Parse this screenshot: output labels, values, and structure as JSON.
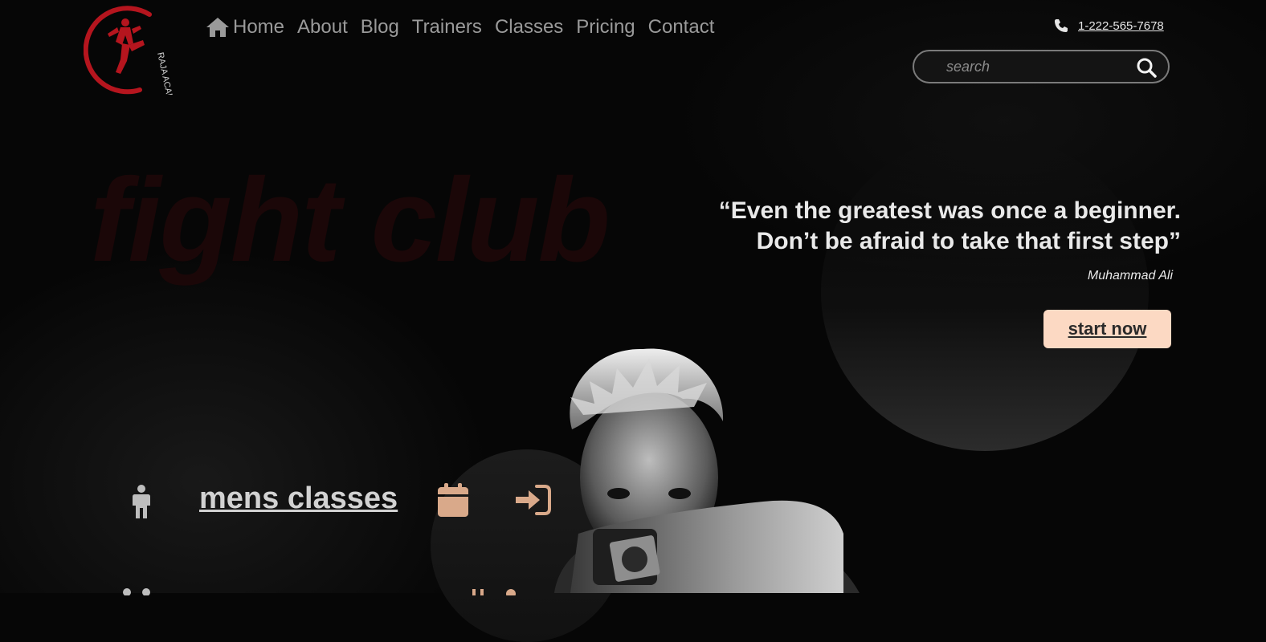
{
  "nav": {
    "items": [
      {
        "label": "Home",
        "icon": "home-icon"
      },
      {
        "label": "About"
      },
      {
        "label": "Blog"
      },
      {
        "label": "Trainers"
      },
      {
        "label": "Classes"
      },
      {
        "label": "Pricing"
      },
      {
        "label": "Contact"
      }
    ]
  },
  "logo": {
    "text": "RAJA ACADEMY",
    "color": "#b5151e"
  },
  "contact": {
    "phone": "1-222-565-7678",
    "icon": "phone-icon"
  },
  "search": {
    "placeholder": "search",
    "icon": "search-icon"
  },
  "hero": {
    "title": "fight club",
    "quote_line1": "“Even the greatest was once a beginner.",
    "quote_line2": "Don’t be afraid to take that first step”",
    "author": "Muhammad Ali",
    "cta": "start now"
  },
  "classes": {
    "label": "mens classes",
    "icons": [
      "person-icon",
      "calendar-icon",
      "sign-in-icon"
    ]
  },
  "colors": {
    "accent": "#fcd9c3",
    "icon_tan": "#d9a98a",
    "brand_red": "#b5151e",
    "background": "#060606"
  }
}
